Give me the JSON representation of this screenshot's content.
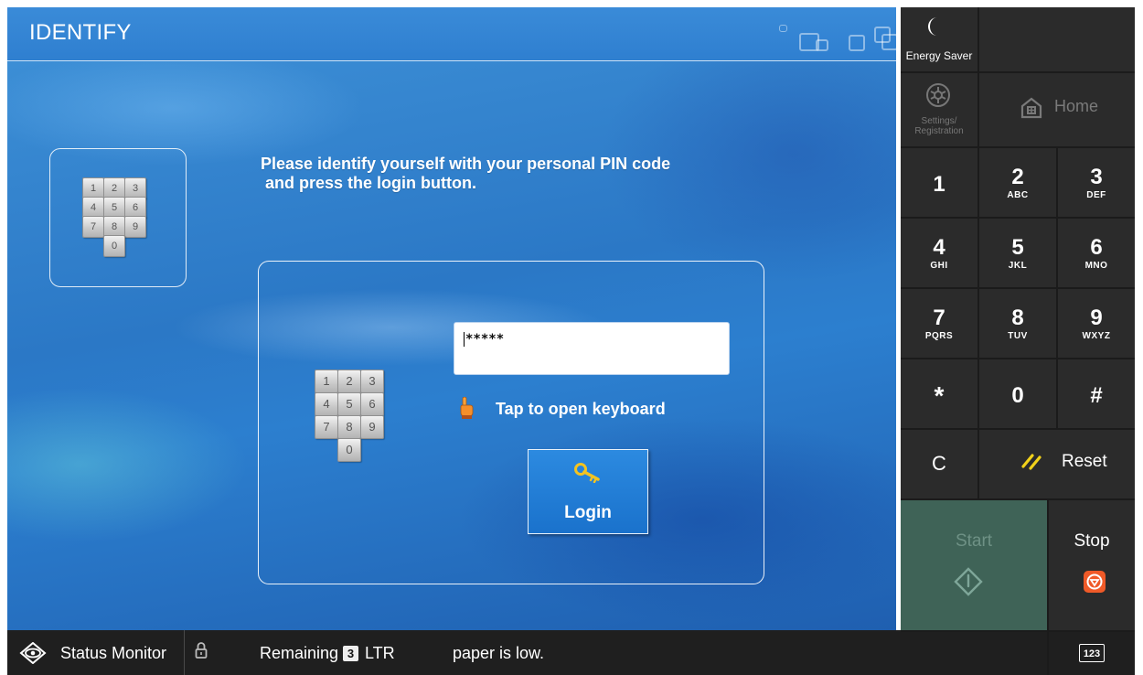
{
  "header": {
    "title": "IDENTIFY"
  },
  "instruction": "Please identify yourself with your personal PIN code\n and press the login button.",
  "keypad_keys": [
    "1",
    "2",
    "3",
    "4",
    "5",
    "6",
    "7",
    "8",
    "9",
    "0"
  ],
  "pin": {
    "value": "*****"
  },
  "tap_hint": "Tap to open keyboard",
  "login": {
    "label": "Login"
  },
  "right_panel": {
    "energy_saver": "Energy Saver",
    "settings": "Settings/\nRegistration",
    "home": "Home",
    "keys": [
      {
        "digit": "1",
        "letters": ""
      },
      {
        "digit": "2",
        "letters": "ABC"
      },
      {
        "digit": "3",
        "letters": "DEF"
      },
      {
        "digit": "4",
        "letters": "GHI"
      },
      {
        "digit": "5",
        "letters": "JKL"
      },
      {
        "digit": "6",
        "letters": "MNO"
      },
      {
        "digit": "7",
        "letters": "PQRS"
      },
      {
        "digit": "8",
        "letters": "TUV"
      },
      {
        "digit": "9",
        "letters": "WXYZ"
      },
      {
        "digit": "*",
        "letters": ""
      },
      {
        "digit": "0",
        "letters": ""
      },
      {
        "digit": "#",
        "letters": ""
      }
    ],
    "clear": "C",
    "reset": "Reset",
    "start": "Start",
    "stop": "Stop",
    "counter_icon_label": "123"
  },
  "status_bar": {
    "status_monitor": "Status Monitor",
    "remaining_label": "Remaining",
    "remaining_count": "3",
    "remaining_unit": "LTR",
    "message": "paper is low."
  },
  "colors": {
    "background_blue": "#2b78c6",
    "panel_dark": "#2b2b2b",
    "start_green": "#3f6357",
    "stop_orange": "#f05a28"
  },
  "icons": [
    "energy-saver-moon-icon",
    "settings-icon",
    "home-icon",
    "reset-slash-icon",
    "start-icon",
    "stop-icon",
    "status-monitor-icon",
    "lock-icon",
    "counter-icon",
    "pointing-hand-icon",
    "key-icon",
    "window-layout-icons"
  ]
}
